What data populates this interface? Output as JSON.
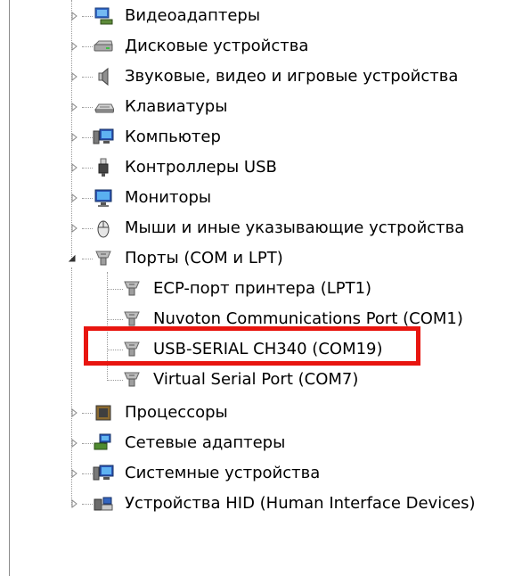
{
  "device_manager": {
    "items": [
      {
        "label": "Видеоадаптеры",
        "icon": "display-adapter-icon",
        "expanded": false
      },
      {
        "label": "Дисковые устройства",
        "icon": "disk-drive-icon",
        "expanded": false
      },
      {
        "label": "Звуковые, видео и игровые устройства",
        "icon": "speaker-icon",
        "expanded": false
      },
      {
        "label": "Клавиатуры",
        "icon": "keyboard-icon",
        "expanded": false
      },
      {
        "label": "Компьютер",
        "icon": "computer-icon",
        "expanded": false
      },
      {
        "label": "Контроллеры USB",
        "icon": "usb-plug-icon",
        "expanded": false
      },
      {
        "label": "Мониторы",
        "icon": "monitor-icon",
        "expanded": false
      },
      {
        "label": "Мыши и иные указывающие устройства",
        "icon": "mouse-icon",
        "expanded": false
      },
      {
        "label": "Порты (COM и LPT)",
        "icon": "port-icon",
        "expanded": true
      },
      {
        "label": "Процессоры",
        "icon": "processor-icon",
        "expanded": false
      },
      {
        "label": "Сетевые адаптеры",
        "icon": "network-adapter-icon",
        "expanded": false
      },
      {
        "label": "Системные устройства",
        "icon": "system-device-icon",
        "expanded": false
      },
      {
        "label": "Устройства HID (Human Interface Devices)",
        "icon": "hid-device-icon",
        "expanded": false
      }
    ],
    "ports_children": [
      {
        "label": "ECP-порт принтера (LPT1)",
        "icon": "port-icon"
      },
      {
        "label": "Nuvoton Communications Port (COM1)",
        "icon": "port-icon"
      },
      {
        "label": "USB-SERIAL CH340 (COM19)",
        "icon": "port-icon"
      },
      {
        "label": "Virtual Serial Port (COM7)",
        "icon": "port-icon"
      }
    ],
    "highlight_color": "#e8150f"
  }
}
